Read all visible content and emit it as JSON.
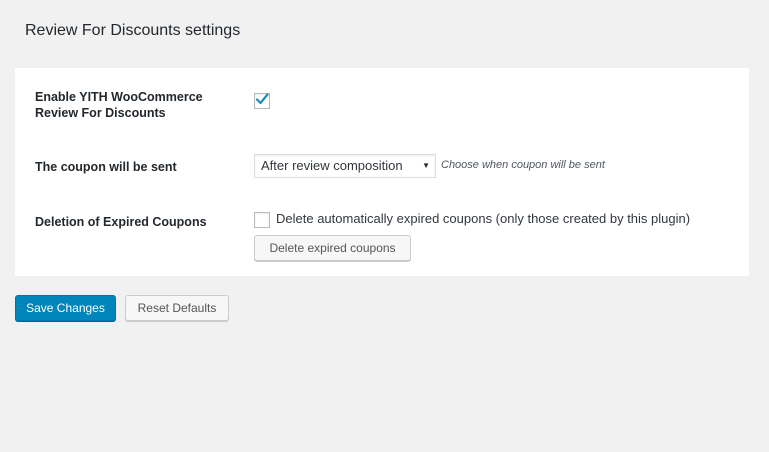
{
  "page": {
    "title": "Review For Discounts settings"
  },
  "settings": {
    "enable": {
      "label": "Enable YITH WooCommerce Review For Discounts",
      "checked": true
    },
    "coupon_sent": {
      "label": "The coupon will be sent",
      "selected": "After review composition",
      "description": "Choose when coupon will be sent"
    },
    "deletion": {
      "label": "Deletion of Expired Coupons",
      "checkbox_label": "Delete automatically expired coupons (only those created by this plugin)",
      "checked": false,
      "button_label": "Delete expired coupons"
    }
  },
  "actions": {
    "save_label": "Save Changes",
    "reset_label": "Reset Defaults"
  },
  "colors": {
    "primary": "#0085ba",
    "check": "#1e8cbe",
    "background": "#f1f1f1"
  }
}
